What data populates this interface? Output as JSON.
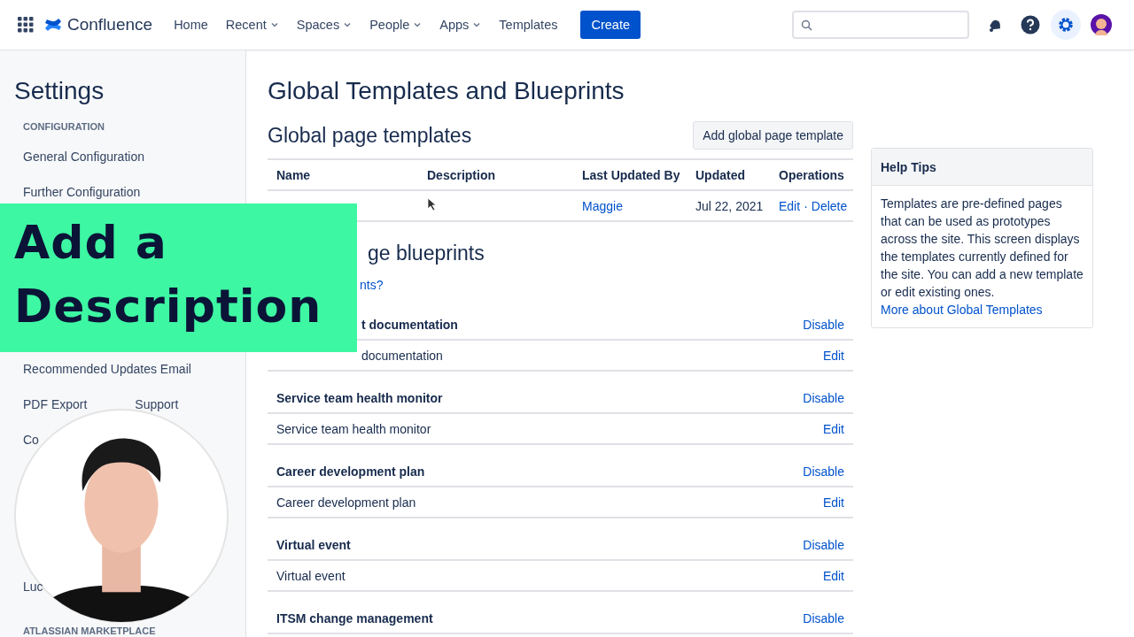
{
  "topbar": {
    "product": "Confluence",
    "nav": [
      {
        "label": "Home",
        "dropdown": false
      },
      {
        "label": "Recent",
        "dropdown": true
      },
      {
        "label": "Spaces",
        "dropdown": true
      },
      {
        "label": "People",
        "dropdown": true
      },
      {
        "label": "Apps",
        "dropdown": true
      },
      {
        "label": "Templates",
        "dropdown": false
      }
    ],
    "create": "Create",
    "settings_active": true
  },
  "sidebar": {
    "title": "Settings",
    "heading": "CONFIGURATION",
    "groups": [
      [
        {
          "label": "General Configuration"
        },
        {
          "label": "Further Configuration"
        }
      ],
      [
        {
          "label": "Recommended Updates Email"
        },
        {
          "label": "PDF Export",
          "tail": "Support"
        },
        {
          "label": "Co"
        }
      ],
      [
        {
          "label": "Luc"
        }
      ]
    ],
    "footer_heading": "ATLASSIAN MARKETPLACE"
  },
  "main": {
    "title": "Global Templates and Blueprints",
    "templates": {
      "title": "Global page templates",
      "add_button": "Add global page template",
      "columns": [
        "Name",
        "Description",
        "Last Updated By",
        "Updated",
        "Operations"
      ],
      "rows": [
        {
          "updated_by": "Maggie",
          "updated": "Jul 22, 2021",
          "operations": [
            "Edit",
            "Delete"
          ],
          "separator": "·"
        }
      ]
    },
    "blueprints": {
      "title": "ge blueprints",
      "link": "nts?",
      "items": [
        {
          "title": "t documentation",
          "action": "Disable",
          "sub": "documentation",
          "sub_action": "Edit",
          "partly_hidden": true
        },
        {
          "title": "Service team health monitor",
          "action": "Disable",
          "sub": "Service team health monitor",
          "sub_action": "Edit",
          "partly_hidden": false
        },
        {
          "title": "Career development plan",
          "action": "Disable",
          "sub": "Career development plan",
          "sub_action": "Edit",
          "partly_hidden": false
        },
        {
          "title": "Virtual event",
          "action": "Disable",
          "sub": "Virtual event",
          "sub_action": "Edit",
          "partly_hidden": false
        },
        {
          "title": "ITSM change management",
          "action": "Disable",
          "partly_hidden": false
        }
      ]
    }
  },
  "help": {
    "title": "Help Tips",
    "text": "Templates are pre-defined pages that can be used as prototypes across the site. This screen displays the templates currently defined for the site. You can add a new template or edit existing ones.",
    "link": "More about Global Templates"
  },
  "banner": {
    "text": "Add a Description"
  }
}
